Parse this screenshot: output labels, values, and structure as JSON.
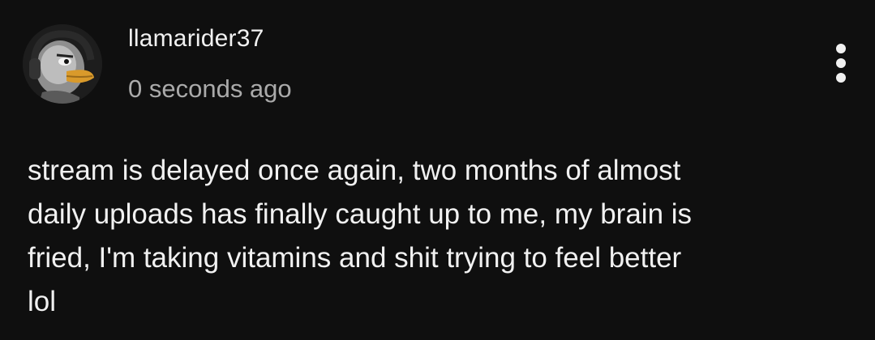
{
  "comment": {
    "author": "llamarider37",
    "timestamp": "0 seconds ago",
    "avatar_icon": "duck-avatar-icon",
    "menu_icon": "more-vertical-icon",
    "text": "stream is delayed once again, two months of almost\ndaily uploads has finally caught up to me, my brain is\nfried, I'm taking vitamins and shit trying to feel better\nlol"
  },
  "colors": {
    "background": "#0f0f0f",
    "primary_text": "#f1f1f1",
    "secondary_text": "#aaaaaa"
  }
}
